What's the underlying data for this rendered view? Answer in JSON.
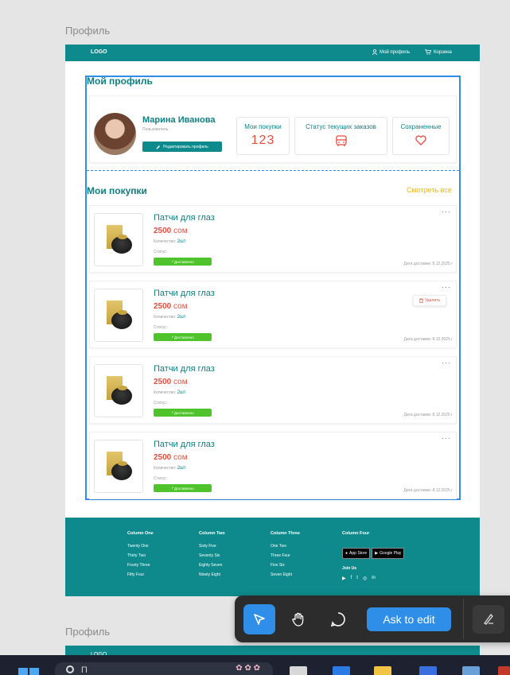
{
  "canvas": {
    "frame_label": "Профиль",
    "frame_label_2": "Профиль"
  },
  "nav": {
    "logo": "LOGO",
    "profile": "Мой профиль",
    "cart": "Корзина"
  },
  "profile": {
    "title": "Мой профиль",
    "name": "Марина Иванова",
    "role": "Пользователь",
    "edit_label": "Редактировать профиль",
    "stats": {
      "purchases_label": "Мои покупки",
      "purchases_count": "123",
      "orders_label": "Статус текущих заказов",
      "saved_label": "Сохраненные"
    }
  },
  "purchases": {
    "title": "Мои покупки",
    "see_all": "Смотреть все",
    "qty_label": "Количество:",
    "status_label": "Статус:",
    "date_label": "Дата доставки:",
    "delete_label": "Удалить",
    "items": [
      {
        "name": "Патчи для глаз",
        "price": "2500",
        "currency": "сом",
        "qty": "2шт",
        "status": "Доставлено",
        "date": "8.12.2025 г"
      },
      {
        "name": "Патчи для глаз",
        "price": "2500",
        "currency": "сом",
        "qty": "2шт",
        "status": "Доставлено",
        "date": "8.12.2025 г"
      },
      {
        "name": "Патчи для глаз",
        "price": "2500",
        "currency": "сом",
        "qty": "2шт",
        "status": "Доставлено",
        "date": "8.12.2025 г"
      },
      {
        "name": "Патчи для глаз",
        "price": "2500",
        "currency": "сом",
        "qty": "2шт",
        "status": "Доставлено",
        "date": "8.12.2025 г"
      }
    ]
  },
  "footer": {
    "columns": [
      {
        "title": "Column One",
        "links": [
          "Twenty One",
          "Thirty Two",
          "Fourty Three",
          "Fifty Four"
        ]
      },
      {
        "title": "Column Two",
        "links": [
          "Sixty Five",
          "Seventy Six",
          "Eighty Seven",
          "Ninety Eight"
        ]
      },
      {
        "title": "Column Three",
        "links": [
          "One Two",
          "Three Four",
          "Five Six",
          "Seven Eight"
        ]
      }
    ],
    "col4_title": "Column Four",
    "app_store": "App Store",
    "google_play": "Google Play",
    "join": "Join Us"
  },
  "toolbar": {
    "ask_to_edit": "Ask to edit"
  },
  "taskbar": {
    "search_placeholder": "П"
  },
  "colors": {
    "primary": "#0e8a8c",
    "accent_red": "#e74c3c",
    "accent_yellow": "#f0b51d",
    "selection": "#2f8fe8",
    "badge_green": "#4fc32c"
  }
}
